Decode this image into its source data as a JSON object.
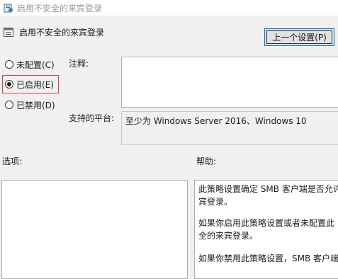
{
  "window": {
    "title": "启用不安全的来宾登录"
  },
  "header": {
    "title": "启用不安全的来宾登录"
  },
  "nav": {
    "prev_button": "上一个设置(P)"
  },
  "state": {
    "options": [
      {
        "label": "未配置(C)",
        "checked": false
      },
      {
        "label": "已启用(E)",
        "checked": true
      },
      {
        "label": "已禁用(D)",
        "checked": false
      }
    ]
  },
  "comment": {
    "label": "注释:",
    "value": ""
  },
  "platform": {
    "label": "支持的平台:",
    "value": "至少为 Windows Server 2016、Windows 10"
  },
  "options_section": {
    "label": "选项:"
  },
  "help": {
    "label": "帮助:",
    "paragraphs": [
      "此策略设置确定 SMB 客户端是否允许\n宾登录。",
      "如果你启用此策略设置或者未配置此\n全的来宾登录。",
      "如果你禁用此策略设置，SMB 客户端"
    ]
  }
}
